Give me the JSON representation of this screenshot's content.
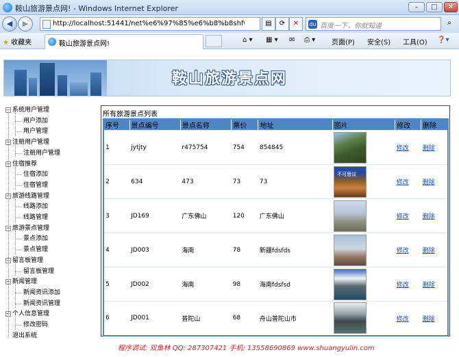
{
  "browser": {
    "window_title": "鞍山旅游景点网! - Windows Internet Explorer",
    "url": "http://localhost:51441/net%e6%97%85%e6%b8%b8shfw%e",
    "search_placeholder": "百度一下，你就知道",
    "favorites_label": "收藏夹",
    "tab_label": "鞍山旅游景点网!",
    "commands": [
      "页面(P)",
      "安全(S)",
      "工具(O)"
    ]
  },
  "banner": {
    "title": "鞍山旅游景点网"
  },
  "sidebar": {
    "groups": [
      {
        "label": "系统用户管理",
        "children": [
          "用户添加",
          "用户管理"
        ]
      },
      {
        "label": "注册用户管理",
        "children": [
          "注册用户管理"
        ]
      },
      {
        "label": "住宿推荐",
        "children": [
          "住宿添加",
          "住宿管理"
        ]
      },
      {
        "label": "旅游线路管理",
        "children": [
          "线路添加",
          "线路管理"
        ]
      },
      {
        "label": "旅游景点管理",
        "children": [
          "景点添加",
          "景点管理"
        ]
      },
      {
        "label": "留言板管理",
        "children": [
          "留言板管理"
        ]
      },
      {
        "label": "新闻管理",
        "children": [
          "新闻资讯添加",
          "新闻资讯管理"
        ]
      },
      {
        "label": "个人信息管理",
        "children": [
          "修改密码"
        ]
      }
    ],
    "logout": "退出系统"
  },
  "list": {
    "title": "所有旅游景点列表",
    "columns": [
      "序号",
      "景点编号",
      "景点名称",
      "票价",
      "地址",
      "图片",
      "修改",
      "删除"
    ],
    "rows": [
      {
        "index": "1",
        "code": "jytjty",
        "name": "r475754",
        "price": "754",
        "address": "854845",
        "edit": "修改",
        "delete": "删除",
        "image": "mountain-cliff-photo"
      },
      {
        "index": "2",
        "code": "634",
        "name": "473",
        "price": "73",
        "address": "73",
        "edit": "修改",
        "delete": "删除",
        "image": "travel-poster-photo",
        "image_caption": "不可思议"
      },
      {
        "index": "3",
        "code": "JD169",
        "name": "广东佛山",
        "price": "120",
        "address": "广东佛山",
        "edit": "修改",
        "delete": "删除",
        "image": "city-skyline-photo"
      },
      {
        "index": "4",
        "code": "JD003",
        "name": "海南",
        "price": "78",
        "address": "新疆fdsfds",
        "edit": "修改",
        "delete": "删除",
        "image": "tower-city-photo"
      },
      {
        "index": "5",
        "code": "JD002",
        "name": "海南",
        "price": "98",
        "address": "海南fdsfsd",
        "edit": "修改",
        "delete": "删除",
        "image": "snow-mountain-lake-photo"
      },
      {
        "index": "6",
        "code": "JD001",
        "name": "普陀山",
        "price": "68",
        "address": "舟山普陀山市",
        "edit": "修改",
        "delete": "删除",
        "image": "temple-village-photo"
      }
    ]
  },
  "footer": {
    "text": "程序调试: 双鱼林   QQ: 287307421   手机: 13558690869   www.shuangyulin.com"
  }
}
